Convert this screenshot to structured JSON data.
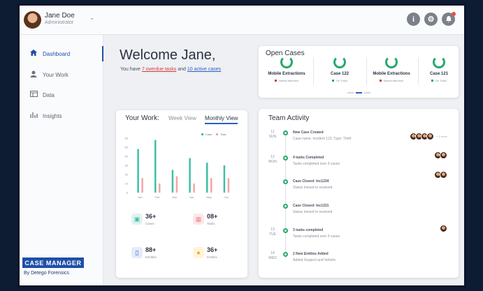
{
  "user": {
    "name": "Jane Doe",
    "role": "Administrator"
  },
  "sidebar": {
    "items": [
      {
        "label": "Dashboard",
        "icon": "home-icon",
        "active": true
      },
      {
        "label": "Your Work",
        "icon": "person-icon",
        "active": false
      },
      {
        "label": "Data",
        "icon": "data-icon",
        "active": false
      },
      {
        "label": "Insights",
        "icon": "bar-chart-icon",
        "active": false
      }
    ]
  },
  "brand": {
    "title": "CASE MANAGER",
    "subtitle": "By Detego Forensics"
  },
  "welcome": {
    "title": "Welcome Jane,",
    "prefix": "You have ",
    "overdue_link": "7 overdue tasks",
    "middle": " and ",
    "active_link": "10 active cases"
  },
  "open_cases": {
    "title": "Open Cases",
    "items": [
      {
        "name": "Mobile Extractions",
        "status": "Needs Attention",
        "status_color": "#d23a3a"
      },
      {
        "name": "Case 122",
        "status": "On Track",
        "status_color": "#28a86b"
      },
      {
        "name": "Mobile Extractions",
        "status": "Needs Attention",
        "status_color": "#d23a3a"
      },
      {
        "name": "Case 121",
        "status": "On Track",
        "status_color": "#28a86b"
      }
    ]
  },
  "your_work": {
    "title": "Your Work:",
    "tabs": [
      "Week View",
      "Monthly View"
    ],
    "legend": [
      "Case",
      "Task"
    ],
    "stats": [
      {
        "value": "36+",
        "label": "Cases",
        "icon": "briefcase-icon"
      },
      {
        "value": "08+",
        "label": "Tasks",
        "icon": "calendar-icon"
      },
      {
        "value": "88+",
        "label": "Exhibits",
        "icon": "phone-icon"
      },
      {
        "value": "36+",
        "label": "Entities",
        "icon": "person-icon"
      }
    ]
  },
  "chart_data": {
    "type": "bar",
    "categories": [
      "Jan",
      "Feb",
      "Mar",
      "Apr",
      "May",
      "Jun"
    ],
    "series": [
      {
        "name": "Case",
        "values": [
          48,
          58,
          25,
          38,
          33,
          30
        ]
      },
      {
        "name": "Task",
        "values": [
          16,
          10,
          18,
          10,
          16,
          16
        ]
      }
    ],
    "yticks": [
      0,
      10,
      20,
      30,
      40,
      50,
      60
    ],
    "ylim": [
      0,
      60
    ],
    "colors": {
      "Case": "#3ec0a6",
      "Task": "#f4a5a8"
    }
  },
  "team_activity": {
    "title": "Team Activity",
    "events": [
      {
        "day": "11",
        "weekday": "SUN",
        "title": "New Case Created",
        "desc": "Case name: Incident 123, Type: Theft",
        "more": "+ 3 more"
      },
      {
        "day": "12",
        "weekday": "MON",
        "title": "4 tasks Completed",
        "desc": "Tasks completed over 3 cases",
        "more": ""
      },
      {
        "day": "",
        "weekday": "",
        "title": "Case Closed: Inc1234",
        "desc": "Status moved to resolved",
        "more": ""
      },
      {
        "day": "",
        "weekday": "",
        "title": "Case Closed: Inc1221",
        "desc": "Status moved to resolved",
        "more": ""
      },
      {
        "day": "13",
        "weekday": "TUE",
        "title": "3 tasks completed",
        "desc": "Tasks completed over 3 cases",
        "more": ""
      },
      {
        "day": "14",
        "weekday": "WED",
        "title": "2 New Entities Added",
        "desc": "Added Suspect and Vehicle",
        "more": ""
      }
    ]
  },
  "top_icons": [
    "info-icon",
    "gear-icon",
    "bell-icon"
  ]
}
